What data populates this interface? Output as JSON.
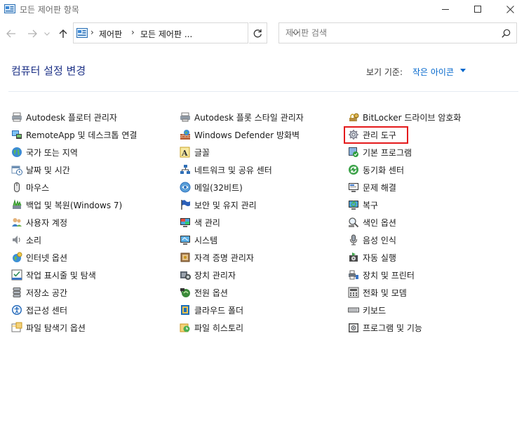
{
  "window": {
    "title": "모든 제어판 항목"
  },
  "address": {
    "segments": [
      "제어판",
      "모든 제어판 ..."
    ]
  },
  "search": {
    "placeholder": "제어판 검색"
  },
  "header": {
    "title": "컴퓨터 설정 변경",
    "view_by_label": "보기 기준:",
    "view_by_value": "작은 아이콘"
  },
  "colors": {
    "title_blue": "#1e3287",
    "link_blue": "#0066cc",
    "highlight_red": "#e41a1c"
  },
  "items": [
    {
      "label": "Autodesk 플로터 관리자",
      "icon": "plotter-icon"
    },
    {
      "label": "RemoteApp 및 데스크톱 연결",
      "icon": "remoteapp-icon"
    },
    {
      "label": "국가 또는 지역",
      "icon": "globe-icon"
    },
    {
      "label": "날짜 및 시간",
      "icon": "calendar-clock-icon"
    },
    {
      "label": "마우스",
      "icon": "mouse-icon"
    },
    {
      "label": "백업 및 복원(Windows 7)",
      "icon": "backup-icon"
    },
    {
      "label": "사용자 계정",
      "icon": "users-icon"
    },
    {
      "label": "소리",
      "icon": "speaker-icon"
    },
    {
      "label": "인터넷 옵션",
      "icon": "internet-icon"
    },
    {
      "label": "작업 표시줄 및 탐색",
      "icon": "taskbar-icon"
    },
    {
      "label": "저장소 공간",
      "icon": "storage-icon"
    },
    {
      "label": "접근성 센터",
      "icon": "accessibility-icon"
    },
    {
      "label": "파일 탐색기 옵션",
      "icon": "folder-options-icon"
    },
    {
      "label": "Autodesk 플롯 스타일 관리자",
      "icon": "plot-style-icon"
    },
    {
      "label": "Windows Defender 방화벽",
      "icon": "firewall-icon"
    },
    {
      "label": "글꼴",
      "icon": "font-icon"
    },
    {
      "label": "네트워크 및 공유 센터",
      "icon": "network-icon"
    },
    {
      "label": "메일(32비트)",
      "icon": "mail-icon"
    },
    {
      "label": "보안 및 유지 관리",
      "icon": "flag-icon"
    },
    {
      "label": "색 관리",
      "icon": "color-icon"
    },
    {
      "label": "시스템",
      "icon": "system-icon"
    },
    {
      "label": "자격 증명 관리자",
      "icon": "credential-icon"
    },
    {
      "label": "장치 관리자",
      "icon": "device-manager-icon"
    },
    {
      "label": "전원 옵션",
      "icon": "power-icon"
    },
    {
      "label": "클라우드 폴더",
      "icon": "cloud-folder-icon"
    },
    {
      "label": "파일 히스토리",
      "icon": "file-history-icon"
    },
    {
      "label": "BitLocker 드라이브 암호화",
      "icon": "bitlocker-icon"
    },
    {
      "label": "관리 도구",
      "icon": "admin-tools-icon"
    },
    {
      "label": "기본 프로그램",
      "icon": "default-programs-icon"
    },
    {
      "label": "동기화 센터",
      "icon": "sync-icon"
    },
    {
      "label": "문제 해결",
      "icon": "troubleshoot-icon"
    },
    {
      "label": "복구",
      "icon": "recovery-icon"
    },
    {
      "label": "색인 옵션",
      "icon": "indexing-icon"
    },
    {
      "label": "음성 인식",
      "icon": "microphone-icon"
    },
    {
      "label": "자동 실행",
      "icon": "autoplay-icon"
    },
    {
      "label": "장치 및 프린터",
      "icon": "printer-icon"
    },
    {
      "label": "전화 및 모뎀",
      "icon": "phone-icon"
    },
    {
      "label": "키보드",
      "icon": "keyboard-icon"
    },
    {
      "label": "프로그램 및 기능",
      "icon": "programs-icon"
    }
  ]
}
